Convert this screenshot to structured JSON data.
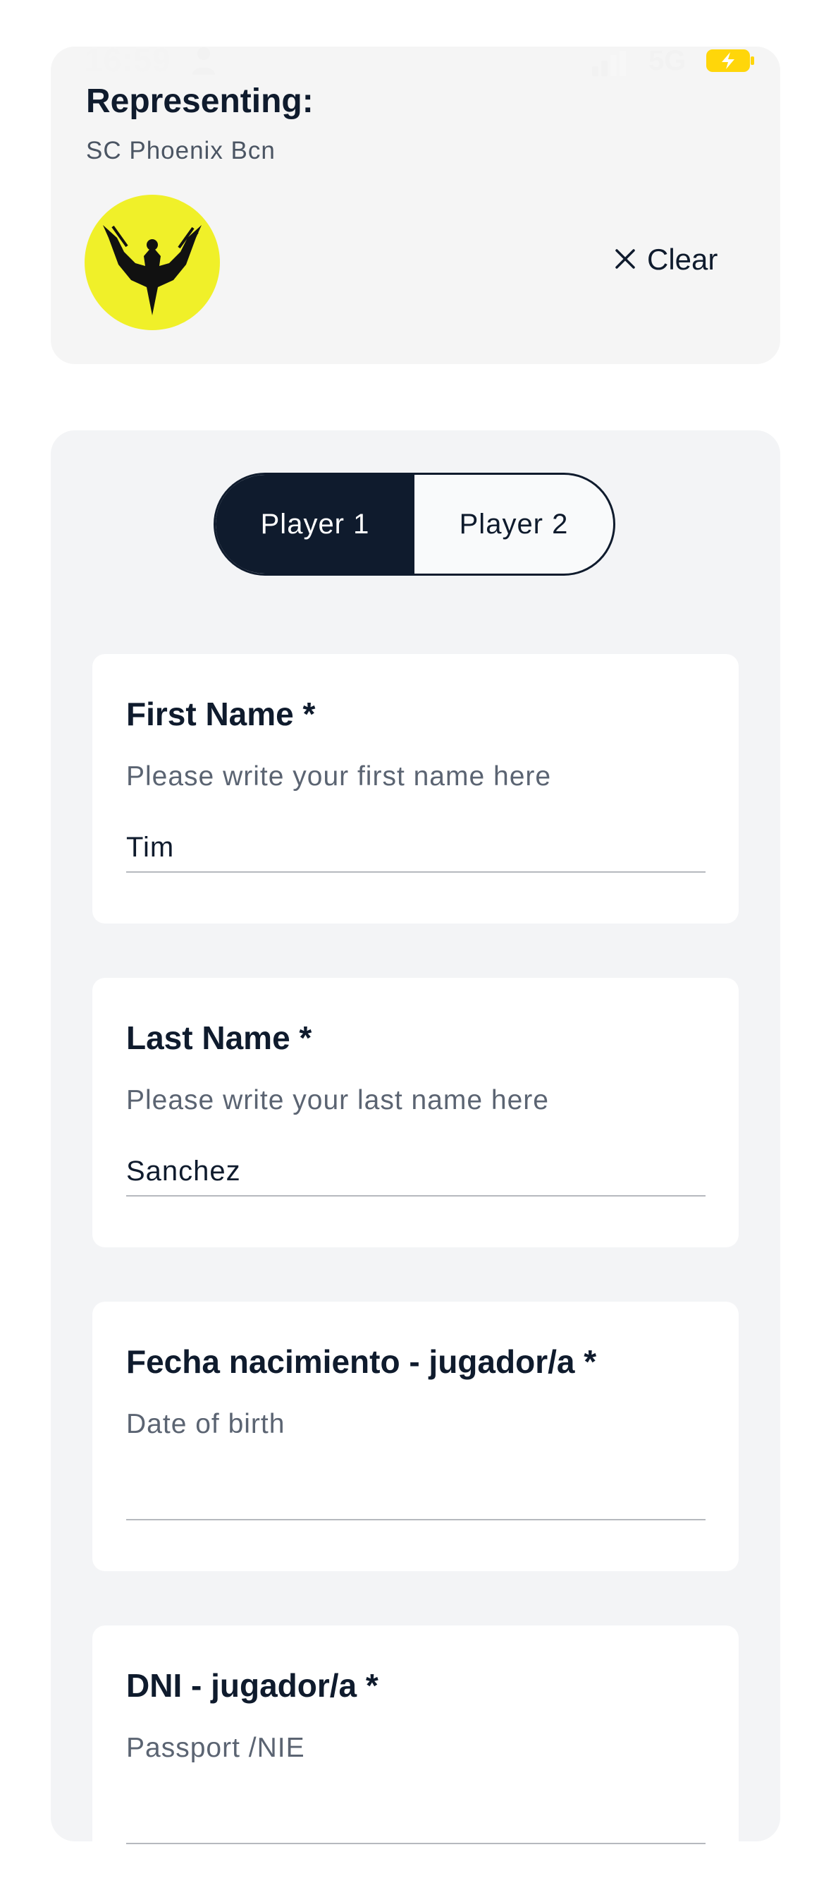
{
  "status_bar": {
    "time": "16:59",
    "network": "5G",
    "icons": [
      "person-icon",
      "signal-icon",
      "battery-icon"
    ]
  },
  "team": {
    "heading": "Representing:",
    "name": "SC Phoenix Bcn",
    "logo_icon": "phoenix-logo-icon",
    "clear_label": "Clear"
  },
  "player_toggle": {
    "options": [
      "Player 1",
      "Player 2"
    ],
    "selected": "Player 1"
  },
  "fields": [
    {
      "label": "First Name *",
      "help": "Please write your first name here",
      "value": "Tim"
    },
    {
      "label": "Last Name *",
      "help": "Please write your last name here",
      "value": "Sanchez"
    },
    {
      "label": "Fecha nacimiento - jugador/a *",
      "help": "Date of birth",
      "value": ""
    },
    {
      "label": "DNI - jugador/a *",
      "help": "Passport /NIE",
      "value": ""
    }
  ],
  "colors": {
    "primary": "#0f1b2d",
    "logo_bg": "#f0f029",
    "battery": "#ffd60a",
    "panel_bg": "#f3f4f6"
  }
}
